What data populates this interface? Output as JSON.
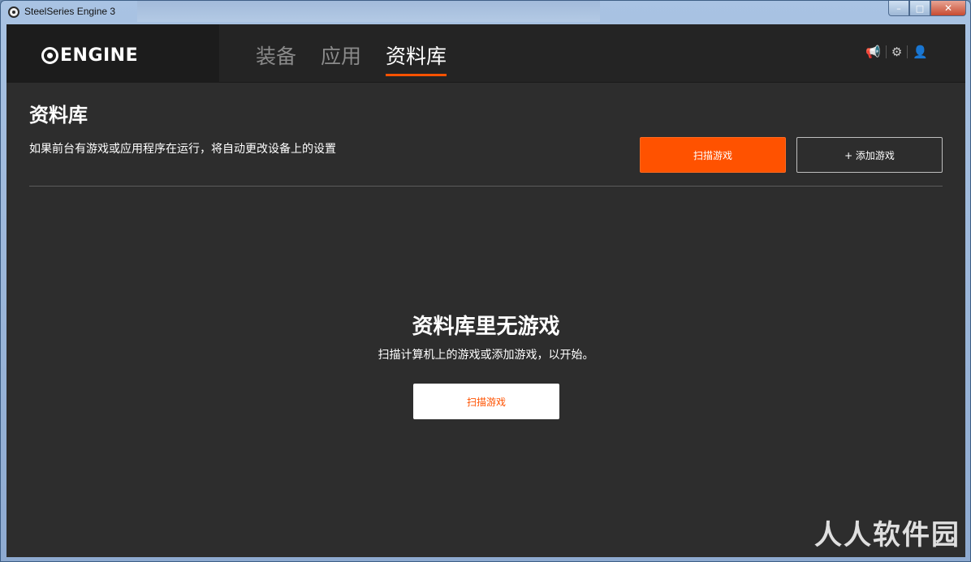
{
  "window": {
    "title": "SteelSeries Engine 3",
    "minimize_icon": "minimize-icon",
    "maximize_icon": "maximize-icon",
    "close_icon": "close-icon"
  },
  "header": {
    "logo_text": "ENGINE",
    "nav": [
      {
        "label": "装备",
        "active": false
      },
      {
        "label": "应用",
        "active": false
      },
      {
        "label": "资料库",
        "active": true
      }
    ],
    "icons": [
      "megaphone-icon",
      "gear-icon",
      "user-icon"
    ]
  },
  "library": {
    "title": "资料库",
    "description": "如果前台有游戏或应用程序在运行，将自动更改设备上的设置",
    "scan_button": "扫描游戏",
    "add_button": "+ 添加游戏"
  },
  "empty_state": {
    "title": "资料库里无游戏",
    "subtitle": "扫描计算机上的游戏或添加游戏，以开始。",
    "scan_button": "扫描游戏"
  },
  "watermark": "人人软件园",
  "colors": {
    "accent": "#ff5200",
    "background": "#2d2d2d",
    "header": "#242424"
  }
}
